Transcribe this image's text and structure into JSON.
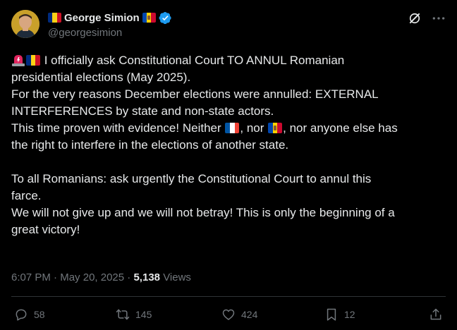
{
  "author": {
    "name": "George Simion",
    "handle": "@georgesimion"
  },
  "tweet": {
    "lines": [
      "I officially ask Constitutional Court TO ANNUL Romanian",
      "presidential elections (May 2025).",
      "For the very reasons December elections were annulled: EXTERNAL",
      "INTERFERENCES by state and non-state actors.",
      "This time proven with evidence! Neither",
      ", nor",
      ", nor anyone else has",
      "the right to interfere in the elections of another state.",
      "To all Romanians: ask urgently the Constitutional Court to annul this",
      "farce.",
      "We will not give up and we will not betray! This is only the beginning of a",
      "great victory!"
    ]
  },
  "meta": {
    "time": "6:07 PM",
    "separator": "·",
    "date": "May 20, 2025",
    "views_count": "5,138",
    "views_label": "Views"
  },
  "actions": {
    "replies": "58",
    "reposts": "145",
    "likes": "424",
    "bookmarks": "12"
  },
  "colors": {
    "background": "#000000",
    "text": "#e7e9ea",
    "secondary_text": "#71767b",
    "verified_blue": "#1d9bf0",
    "divider": "#2f3336"
  },
  "icons": {
    "verified": "verified-badge-icon",
    "grok": "grok-icon",
    "more": "more-options-icon",
    "siren": "rotating-light-icon",
    "reply": "reply-icon",
    "repost": "repost-icon",
    "like": "heart-icon",
    "bookmark": "bookmark-icon",
    "share": "share-icon"
  }
}
